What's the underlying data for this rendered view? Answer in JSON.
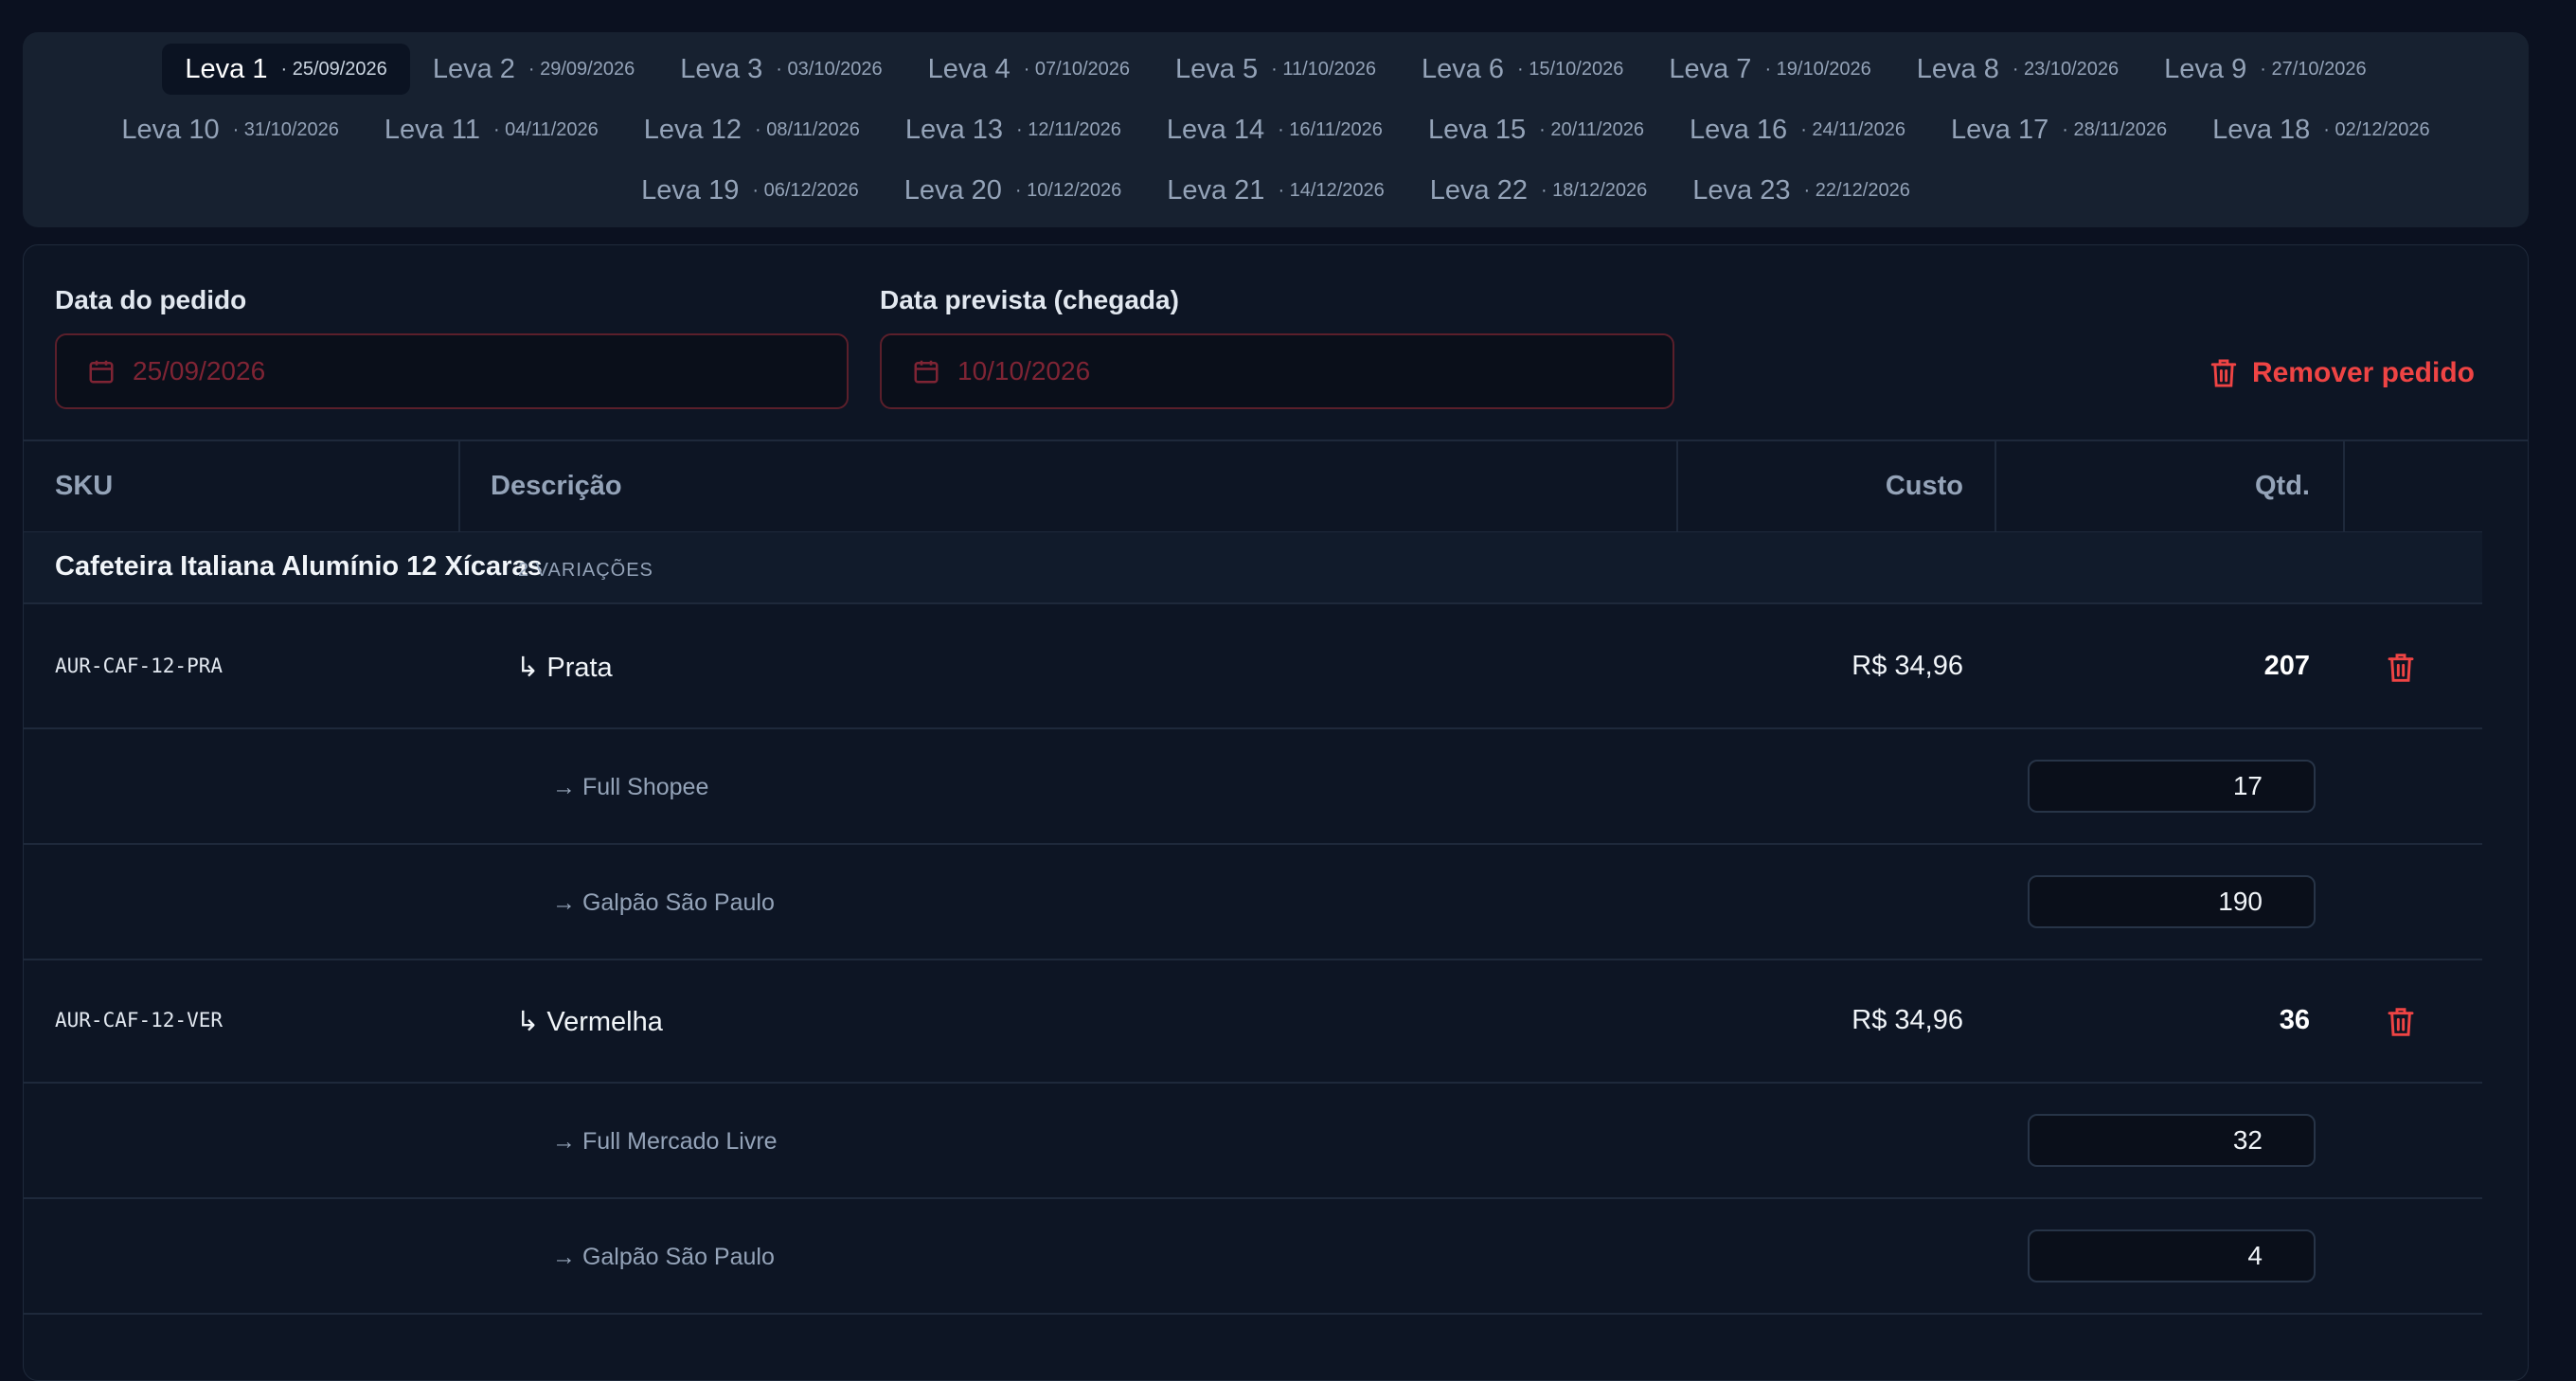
{
  "tabs": [
    {
      "name": "Leva 1",
      "date": "· 25/09/2026",
      "active": true
    },
    {
      "name": "Leva 2",
      "date": "· 29/09/2026"
    },
    {
      "name": "Leva 3",
      "date": "· 03/10/2026"
    },
    {
      "name": "Leva 4",
      "date": "· 07/10/2026"
    },
    {
      "name": "Leva 5",
      "date": "· 11/10/2026"
    },
    {
      "name": "Leva 6",
      "date": "· 15/10/2026"
    },
    {
      "name": "Leva 7",
      "date": "· 19/10/2026"
    },
    {
      "name": "Leva 8",
      "date": "· 23/10/2026"
    },
    {
      "name": "Leva 9",
      "date": "· 27/10/2026"
    },
    {
      "name": "Leva 10",
      "date": "· 31/10/2026"
    },
    {
      "name": "Leva 11",
      "date": "· 04/11/2026"
    },
    {
      "name": "Leva 12",
      "date": "· 08/11/2026"
    },
    {
      "name": "Leva 13",
      "date": "· 12/11/2026"
    },
    {
      "name": "Leva 14",
      "date": "· 16/11/2026"
    },
    {
      "name": "Leva 15",
      "date": "· 20/11/2026"
    },
    {
      "name": "Leva 16",
      "date": "· 24/11/2026"
    },
    {
      "name": "Leva 17",
      "date": "· 28/11/2026"
    },
    {
      "name": "Leva 18",
      "date": "· 02/12/2026"
    },
    {
      "name": "Leva 19",
      "date": "· 06/12/2026"
    },
    {
      "name": "Leva 20",
      "date": "· 10/12/2026"
    },
    {
      "name": "Leva 21",
      "date": "· 14/12/2026"
    },
    {
      "name": "Leva 22",
      "date": "· 18/12/2026"
    },
    {
      "name": "Leva 23",
      "date": "· 22/12/2026"
    }
  ],
  "order": {
    "order_date_label": "Data do pedido",
    "order_date_value": "25/09/2026",
    "arrival_date_label": "Data prevista (chegada)",
    "arrival_date_value": "10/10/2026",
    "remove_label": "Remover pedido"
  },
  "table": {
    "headers": {
      "sku": "SKU",
      "description": "Descrição",
      "cost": "Custo",
      "qty": "Qtd."
    },
    "product": {
      "name": "Cafeteira Italiana Alumínio 12 Xícaras",
      "variations": "2 VARIAÇÕES"
    },
    "variants": [
      {
        "sku": "AUR-CAF-12-PRA",
        "name": "↳ Prata",
        "cost": "R$ 34,96",
        "qty": "207",
        "destinations": [
          {
            "name": "→ Full Shopee",
            "qty": "17"
          },
          {
            "name": "→ Galpão São Paulo",
            "qty": "190"
          }
        ]
      },
      {
        "sku": "AUR-CAF-12-VER",
        "name": "↳ Vermelha",
        "cost": "R$ 34,96",
        "qty": "36",
        "destinations": [
          {
            "name": "→ Full Mercado Livre",
            "qty": "32"
          },
          {
            "name": "→ Galpão São Paulo",
            "qty": "4"
          }
        ]
      }
    ]
  },
  "colors": {
    "accent_red": "#ef4444",
    "background": "#0b1120",
    "panel": "#172130"
  },
  "icons": {
    "date": "calendar-icon",
    "remove": "trash-icon"
  }
}
